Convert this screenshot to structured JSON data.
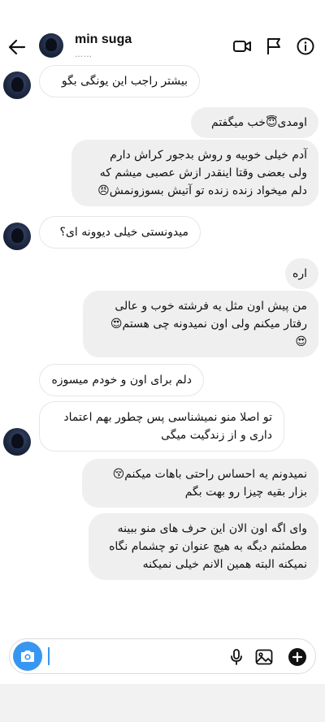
{
  "header": {
    "contact_name": "min suga",
    "status_text": "……",
    "icons": [
      "back-arrow-icon",
      "video-call-icon",
      "flag-icon",
      "info-icon"
    ]
  },
  "messages": [
    {
      "side": "received",
      "text": "بیشتر راجب این یونگی بگو"
    },
    {
      "side": "sent",
      "text": "اومدی😇خب میگفتم"
    },
    {
      "side": "sent",
      "text": "آدم خیلی خوبیه و روش بدجور کراش دارم\nولی بعضی وقتا اینقدر ازش عصبی میشم که\nدلم میخواد زنده زنده تو آتیش بسوزونمش😠"
    },
    {
      "side": "received",
      "text": "میدونستی خیلی دیوونه ای؟"
    },
    {
      "side": "sent",
      "text": "اره"
    },
    {
      "side": "sent",
      "text": "من پیش اون مثل یه فرشته خوب و عالی\nرفتار میکنم ولی اون نمیدونه چی هستم😍\n😍"
    },
    {
      "side": "received",
      "text": "دلم برای اون و خودم میسوزه"
    },
    {
      "side": "received",
      "text": "تو اصلا منو نمیشناسی پس چطور بهم اعتماد\nداری و از زندگیت میگی"
    },
    {
      "side": "sent",
      "text": "نمیدونم یه احساس راحتی باهات میکنم😚\nبزار بقیه چیزا رو بهت بگم"
    },
    {
      "side": "sent",
      "text": "وای اگه اون الان این حرف های منو ببینه\nمطمئنم دیگه به هیچ عنوان تو چشمام نگاه\nنمیکنه البته همین الانم خیلی نمیکنه"
    }
  ],
  "composer": {
    "placeholder": "",
    "icons": [
      "camera-icon",
      "microphone-icon",
      "gallery-icon",
      "add-icon"
    ]
  },
  "colors": {
    "accent": "#3797f0",
    "sent_bubble": "#efefef",
    "received_border": "#e6e6e6"
  }
}
